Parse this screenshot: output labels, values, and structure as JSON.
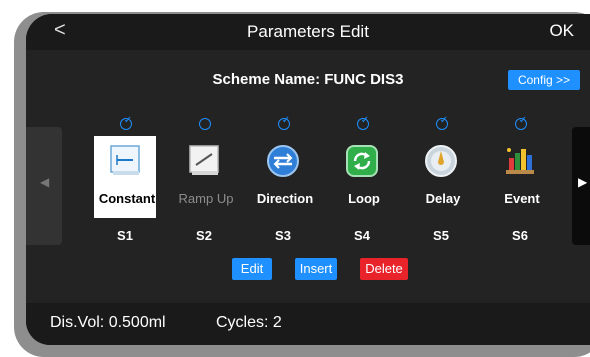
{
  "titlebar": {
    "back_glyph": "<",
    "title": "Parameters Edit",
    "ok_label": "OK"
  },
  "scheme": {
    "text": "Scheme Name: FUNC DIS3",
    "config_label": "Config >>"
  },
  "nav": {
    "left_glyph": "◀",
    "right_glyph": "▶"
  },
  "steps": [
    {
      "label": "Constant",
      "id": "S1",
      "checked": true,
      "selected": true,
      "dim": false,
      "icon": "constant-icon"
    },
    {
      "label": "Ramp Up",
      "id": "S2",
      "checked": false,
      "selected": false,
      "dim": true,
      "icon": "ramp-up-icon"
    },
    {
      "label": "Direction",
      "id": "S3",
      "checked": true,
      "selected": false,
      "dim": false,
      "icon": "direction-icon"
    },
    {
      "label": "Loop",
      "id": "S4",
      "checked": true,
      "selected": false,
      "dim": false,
      "icon": "loop-icon"
    },
    {
      "label": "Delay",
      "id": "S5",
      "checked": true,
      "selected": false,
      "dim": false,
      "icon": "delay-icon"
    },
    {
      "label": "Event",
      "id": "S6",
      "checked": true,
      "selected": false,
      "dim": false,
      "icon": "event-icon"
    }
  ],
  "actions": {
    "edit": "Edit",
    "insert": "Insert",
    "delete": "Delete"
  },
  "status": {
    "dis_vol": "Dis.Vol: 0.500ml",
    "cycles": "Cycles: 2"
  },
  "colors": {
    "accent": "#1e90ff",
    "danger": "#e8232a",
    "background": "#232323"
  }
}
